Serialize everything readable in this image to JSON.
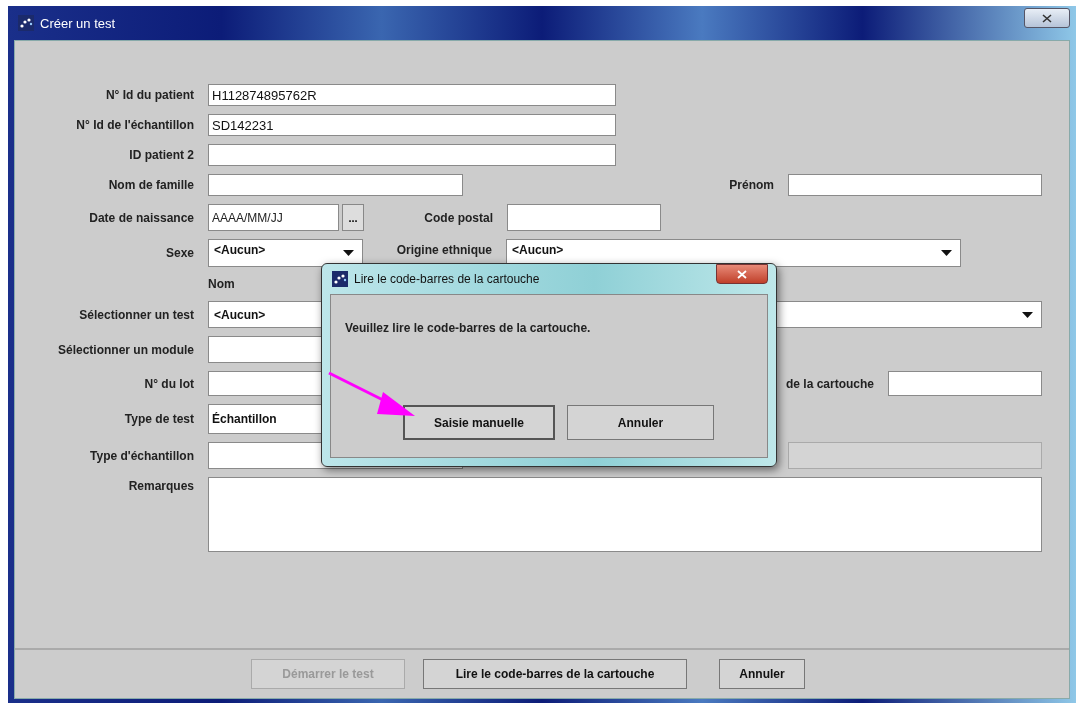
{
  "window": {
    "title": "Créer un test"
  },
  "form": {
    "patient_id": {
      "label": "N° Id du patient",
      "value": "H112874895762R"
    },
    "sample_id": {
      "label": "N° Id de l'échantillon",
      "value": "SD142231"
    },
    "patient_id_2": {
      "label": "ID patient 2"
    },
    "last_name": {
      "label": "Nom de famille"
    },
    "first_name": {
      "label": "Prénom"
    },
    "birth_date": {
      "label": "Date de naissance",
      "placeholder": "AAAA/MM/JJ",
      "button": "..."
    },
    "postal_code": {
      "label": "Code postal"
    },
    "sex": {
      "label": "Sexe",
      "value": "<Aucun>"
    },
    "ethnic_origin": {
      "label": "Origine ethnique",
      "value": "<Aucun>"
    },
    "column_header": "Nom",
    "test": {
      "label": "Sélectionner un test",
      "value": "<Aucun>"
    },
    "module": {
      "label": "Sélectionner un module"
    },
    "lot": {
      "label": "N° du lot"
    },
    "cartridge": {
      "label": "de la cartouche"
    },
    "test_type": {
      "label": "Type de test",
      "value": "Échantillon"
    },
    "sample_type": {
      "label": "Type d'échantillon"
    },
    "field_4": {
      "disabled": true
    },
    "remarks": {
      "label": "Remarques"
    }
  },
  "buttons": [
    {
      "label": "Démarrer le test",
      "disabled": true
    },
    {
      "label": "Lire le code-barres de la cartouche",
      "disabled": false
    },
    {
      "label": "Annuler",
      "disabled": false
    }
  ],
  "dialog": {
    "title": "Lire le code-barres de la cartouche",
    "message": "Veuillez lire le code-barres de la cartouche.",
    "buttons": [
      {
        "label": "Saisie manuelle",
        "selected": true
      },
      {
        "label": "Annuler",
        "selected": false
      }
    ]
  }
}
